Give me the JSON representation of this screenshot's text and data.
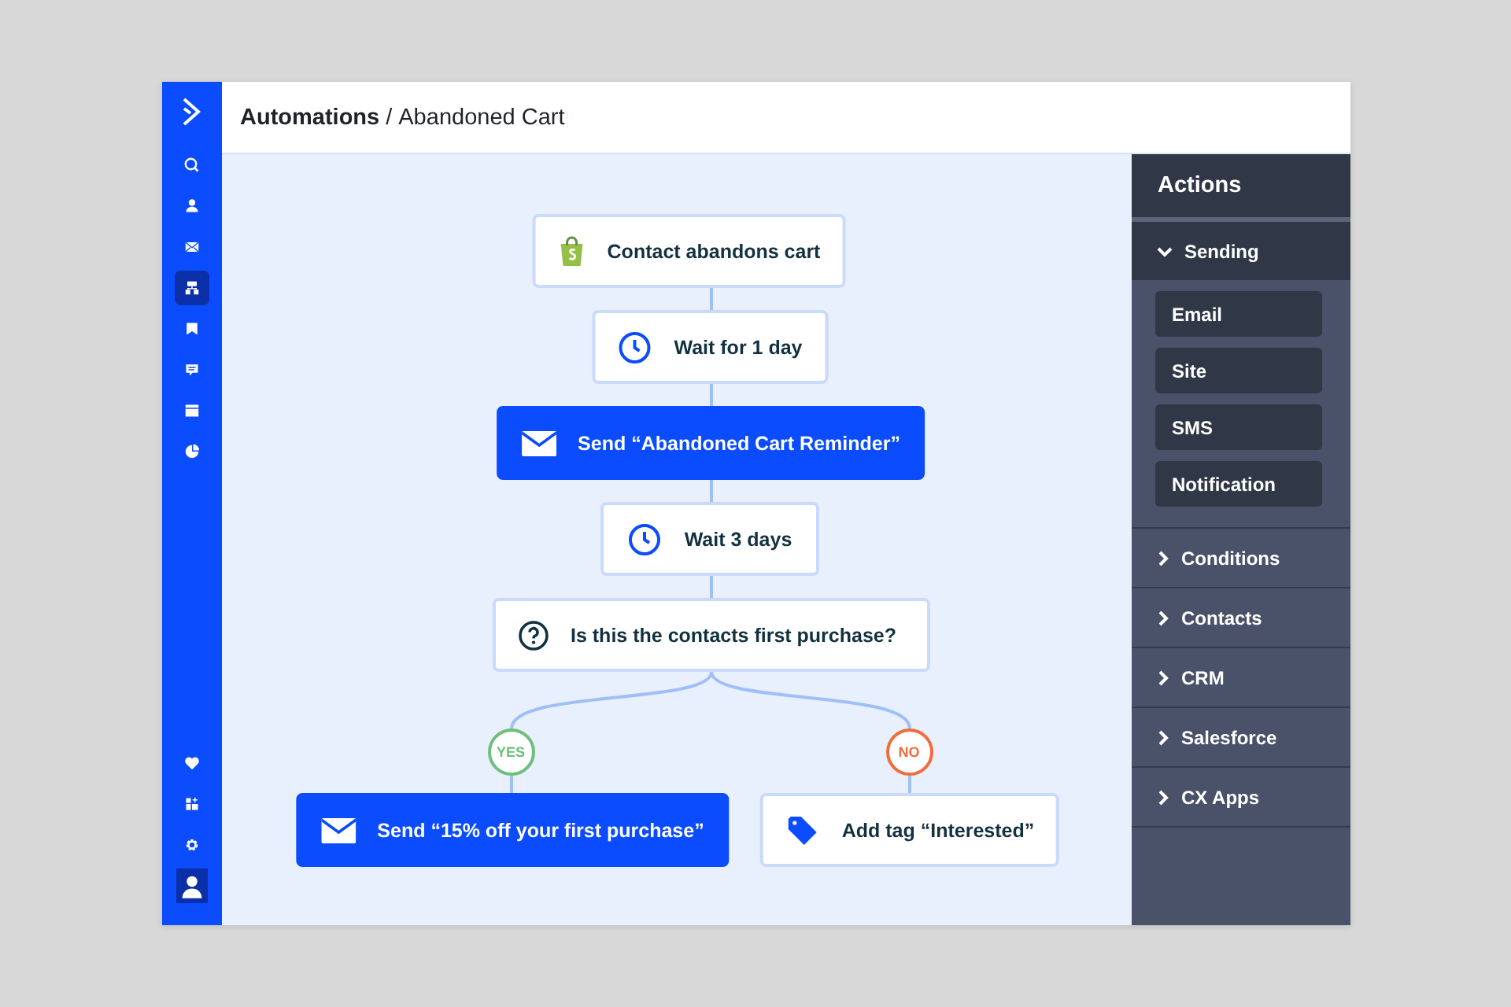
{
  "nav": {
    "top": [
      {
        "kind": "search",
        "selected": false
      },
      {
        "kind": "person",
        "selected": false
      },
      {
        "kind": "mail",
        "selected": false
      },
      {
        "kind": "flow",
        "selected": true
      },
      {
        "kind": "flag",
        "selected": false
      },
      {
        "kind": "chat",
        "selected": false
      },
      {
        "kind": "browser",
        "selected": false
      },
      {
        "kind": "pie",
        "selected": false
      }
    ],
    "bottom": [
      {
        "kind": "heart",
        "selected": false
      },
      {
        "kind": "apps",
        "selected": false
      },
      {
        "kind": "gear",
        "selected": false
      },
      {
        "kind": "avatar",
        "selected": true
      }
    ]
  },
  "header": {
    "section": "Automations",
    "separator": "/",
    "page": "Abandoned Cart"
  },
  "flow": {
    "nodes": [
      {
        "kind": "trigger",
        "text": "Contact abandons cart"
      },
      {
        "kind": "wait",
        "text": "Wait for 1 day"
      },
      {
        "kind": "send",
        "text": "Send “Abandoned Cart Reminder”"
      },
      {
        "kind": "wait",
        "text": "Wait 3 days"
      },
      {
        "kind": "condition",
        "text": "Is this the contacts first purchase?"
      },
      {
        "kind": "send",
        "text": "Send “15% off your first purchase”"
      },
      {
        "kind": "tag",
        "text": "Add tag “Interested”"
      }
    ],
    "branches": [
      {
        "label": "YES",
        "color": "#6dbf7b"
      },
      {
        "label": "NO",
        "color": "#f26b3a"
      }
    ]
  },
  "actions": {
    "title": "Actions",
    "groups": [
      {
        "label": "Sending",
        "expanded": true,
        "items": [
          "Email",
          "Site",
          "SMS",
          "Notification"
        ]
      },
      {
        "label": "Conditions",
        "expanded": false
      },
      {
        "label": "Contacts",
        "expanded": false
      },
      {
        "label": "CRM",
        "expanded": false
      },
      {
        "label": "Salesforce",
        "expanded": false
      },
      {
        "label": "CX Apps",
        "expanded": false
      }
    ]
  }
}
